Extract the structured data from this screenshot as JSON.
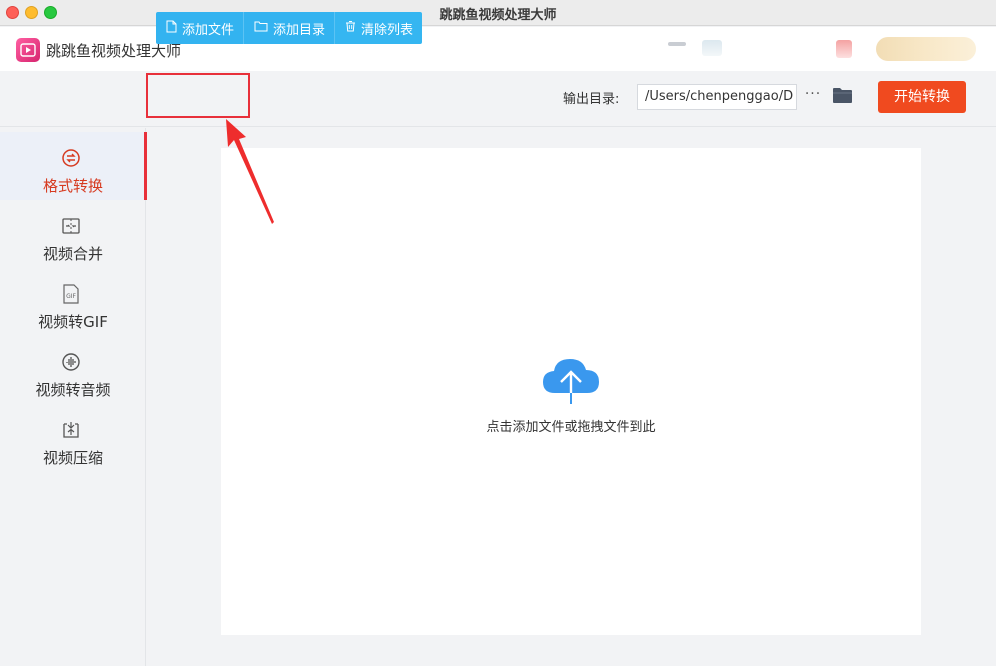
{
  "window": {
    "title": "跳跳鱼视频处理大师"
  },
  "app": {
    "name": "跳跳鱼视频处理大师"
  },
  "toolbar": {
    "add_file": "添加文件",
    "add_dir": "添加目录",
    "clear_list": "清除列表",
    "output_label": "输出目录:",
    "output_path": "/Users/chenpenggao/D",
    "more": "···",
    "start": "开始转换"
  },
  "sidebar": {
    "items": [
      {
        "label": "格式转换",
        "icon": "format-convert-icon",
        "active": true
      },
      {
        "label": "视频合并",
        "icon": "video-merge-icon"
      },
      {
        "label": "视频转GIF",
        "icon": "gif-icon"
      },
      {
        "label": "视频转音频",
        "icon": "audio-icon"
      },
      {
        "label": "视频压缩",
        "icon": "compress-icon"
      }
    ]
  },
  "dropzone": {
    "hint": "点击添加文件或拖拽文件到此"
  },
  "colors": {
    "accent": "#33b3f0",
    "start": "#f04a1f",
    "active": "#d63a20",
    "highlight": "#e8303a"
  }
}
